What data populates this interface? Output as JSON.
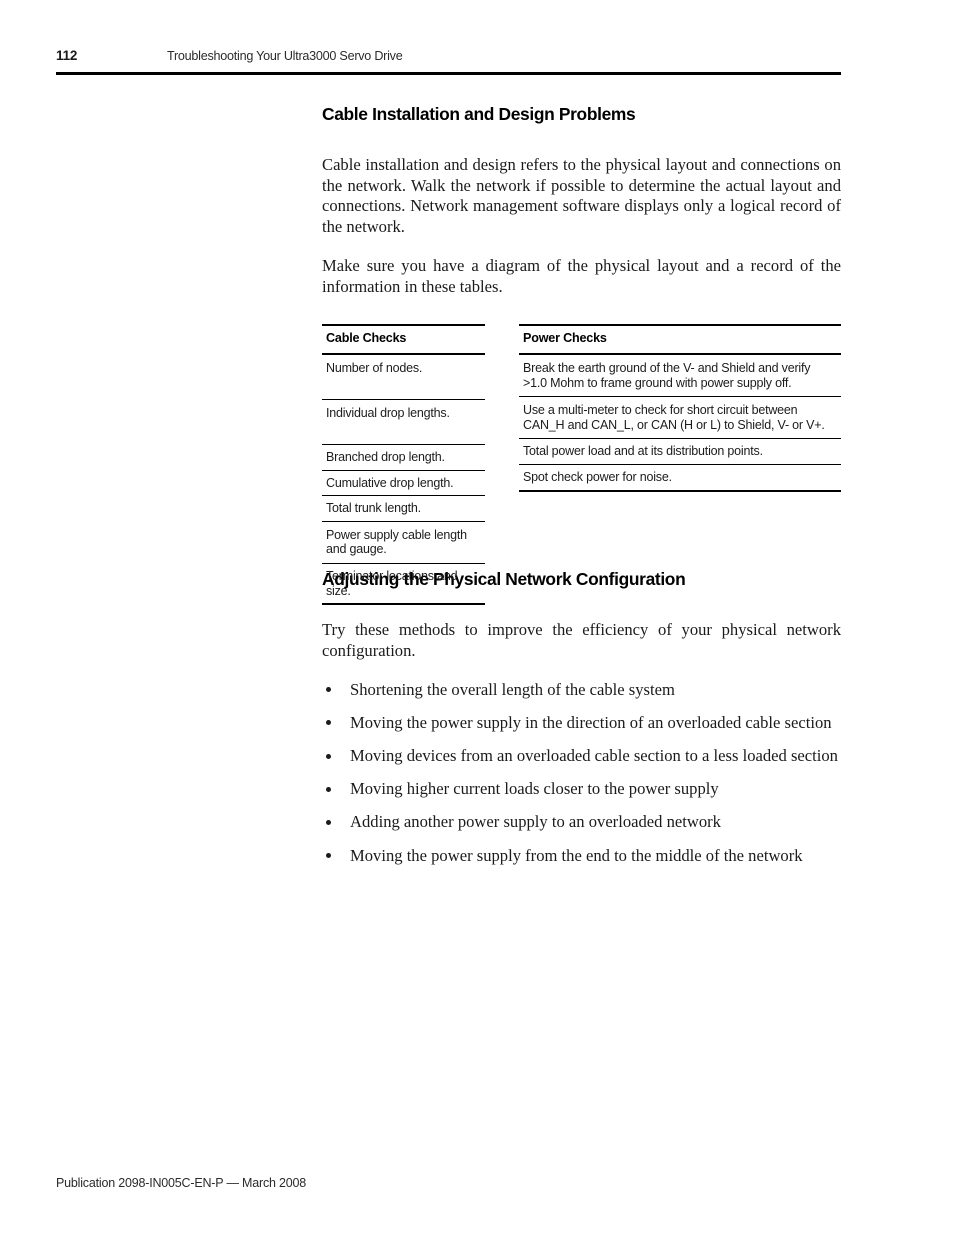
{
  "header": {
    "page_number": "112",
    "title": "Troubleshooting Your Ultra3000 Servo Drive"
  },
  "sections": [
    {
      "heading": "Cable Installation and Design Problems",
      "paragraphs": [
        "Cable installation and design refers to the physical layout and connections on the network. Walk the network if possible to determine the actual layout and connections. Network management software displays only a logical record of the network.",
        "Make sure you have a diagram of the physical layout and a record of the information in these tables."
      ]
    },
    {
      "heading": "Adjusting the Physical Network Configuration",
      "paragraphs": [
        "Try these methods to improve the efficiency of your physical network configuration."
      ],
      "bullets": [
        "Shortening the overall length of the cable system",
        "Moving the power supply in the direction of an overloaded cable section",
        "Moving devices from an overloaded cable section to a less loaded section",
        "Moving higher current loads closer to the power supply",
        "Adding another power supply to an overloaded network",
        "Moving the power supply from the end to the middle of the network"
      ]
    }
  ],
  "tables": {
    "cable_checks": {
      "header": "Cable Checks",
      "rows": [
        "Number of nodes.",
        "Individual drop lengths.",
        "Branched drop length.",
        "Cumulative drop length.",
        "Total trunk length.",
        "Power supply cable length and gauge.",
        "Terminator locations and size."
      ]
    },
    "power_checks": {
      "header": "Power Checks",
      "rows": [
        "Break the earth ground of the V- and Shield and verify >1.0 Mohm to frame ground with power supply off.",
        "Use a multi-meter to check for short circuit between CAN_H and CAN_L, or CAN (H or L) to Shield, V- or V+.",
        "Total power load and at its distribution points.",
        "Spot check power for noise."
      ]
    }
  },
  "footer": {
    "publication": "Publication 2098-IN005C-EN-P — March 2008"
  },
  "colors": {
    "text": "#1b1b1b",
    "rule": "#000000",
    "background": "#ffffff"
  }
}
